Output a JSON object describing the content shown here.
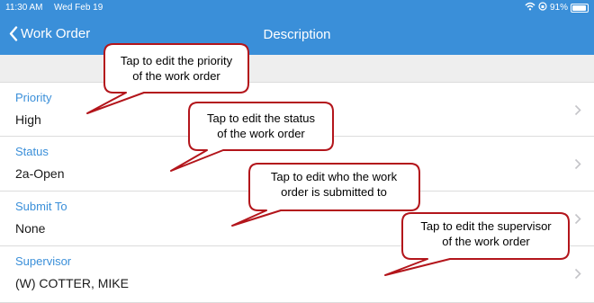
{
  "status_bar": {
    "time": "11:30 AM",
    "date": "Wed Feb 19",
    "battery": "91%",
    "battery_level": 0.91
  },
  "nav": {
    "back_label": "Work Order",
    "title": "Description"
  },
  "rows": [
    {
      "label": "Priority",
      "value": "High"
    },
    {
      "label": "Status",
      "value": "2a-Open"
    },
    {
      "label": "Submit To",
      "value": "None"
    },
    {
      "label": "Supervisor",
      "value": "(W) COTTER, MIKE"
    }
  ],
  "callouts": [
    {
      "line1": "Tap to edit the priority",
      "line2": "of the work order"
    },
    {
      "line1": "Tap to edit the status",
      "line2": "of the work order"
    },
    {
      "line1": "Tap to edit who the work",
      "line2": "order is submitted to"
    },
    {
      "line1": "Tap to edit the supervisor",
      "line2": "of the work order"
    }
  ],
  "colors": {
    "accent": "#3a8fd9",
    "callout_border": "#b3151b"
  }
}
